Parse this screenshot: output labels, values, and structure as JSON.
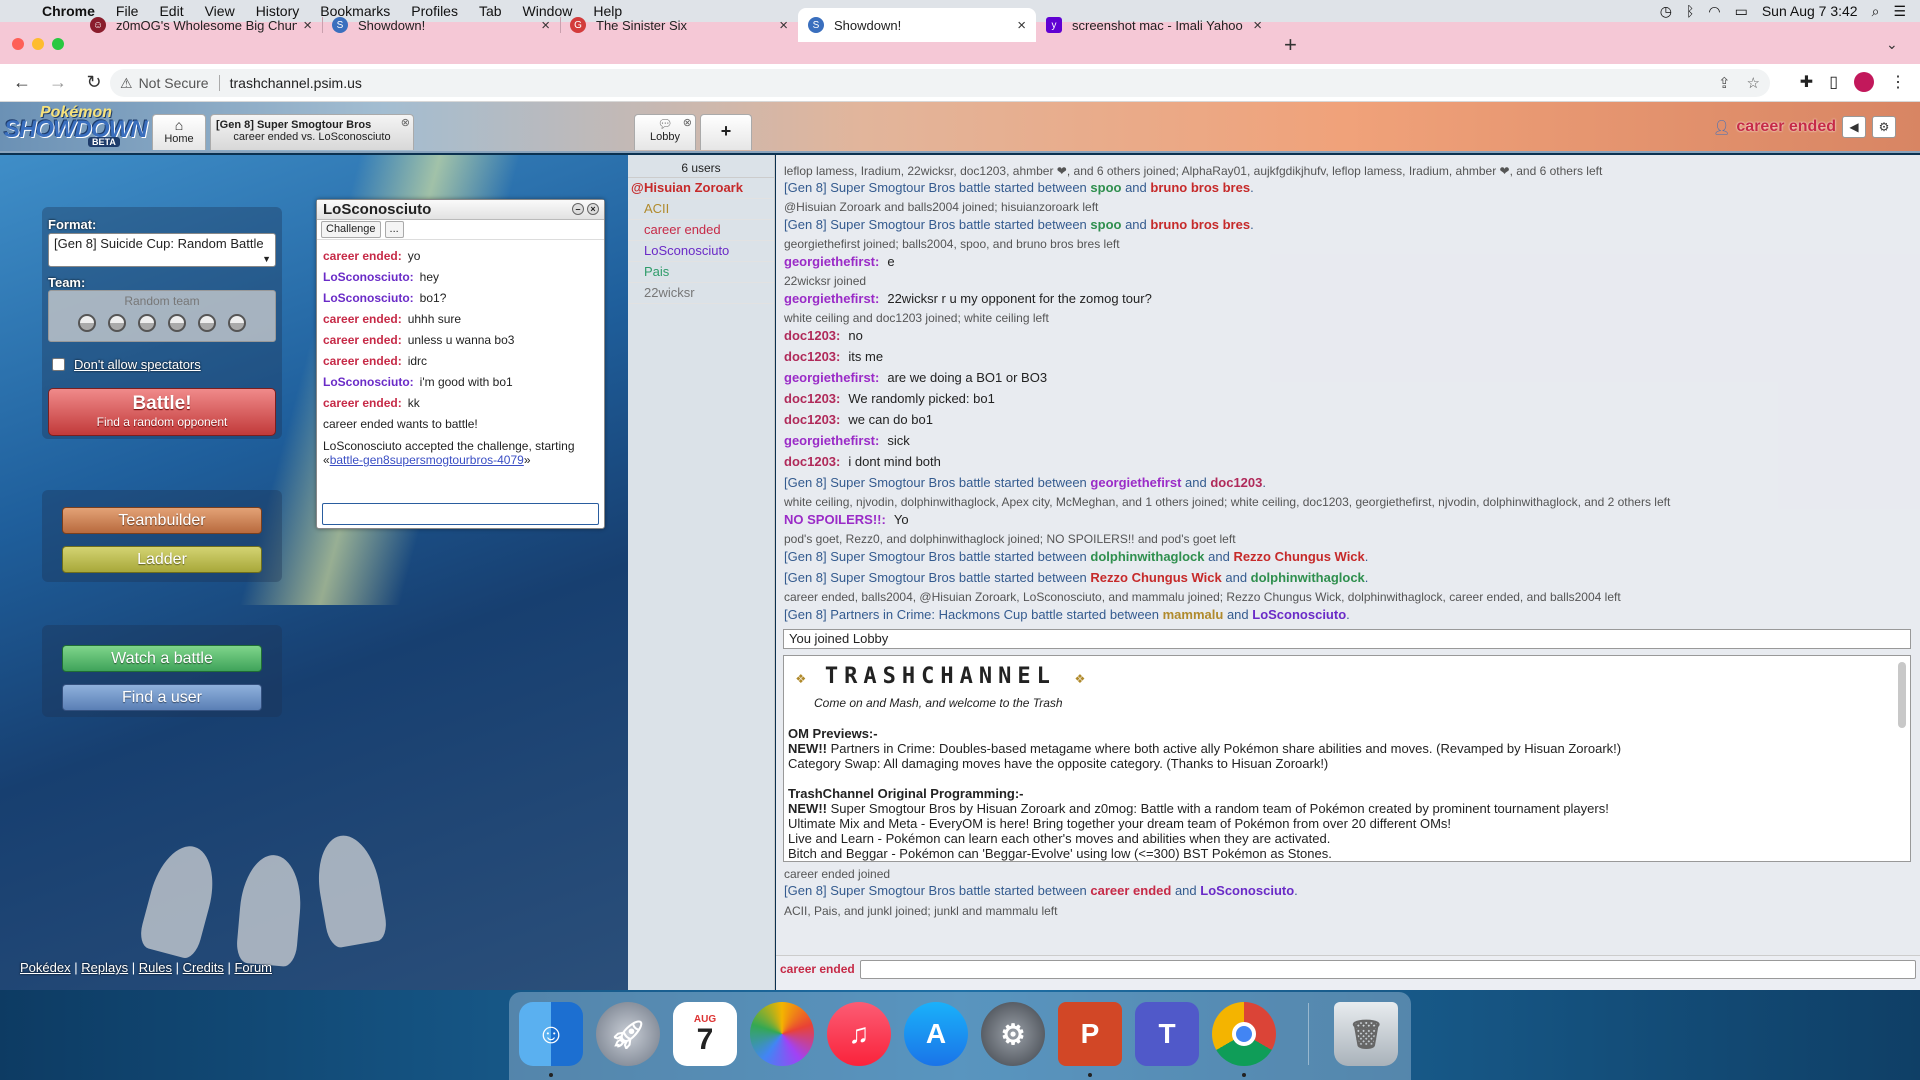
{
  "menubar": {
    "apple": "",
    "app": "Chrome",
    "items": [
      "File",
      "Edit",
      "View",
      "History",
      "Bookmarks",
      "Profiles",
      "Tab",
      "Window",
      "Help"
    ],
    "datetime": "Sun Aug 7  3:42"
  },
  "browser": {
    "tabs": [
      {
        "title": "z0mOG's Wholesome Big Chun",
        "fav_color": "#8a1d2c"
      },
      {
        "title": "Showdown!",
        "fav_color": "#3a6fbe"
      },
      {
        "title": "The Sinister Six",
        "fav_color": "#d33b3b"
      },
      {
        "title": "Showdown!",
        "fav_color": "#3a6fbe"
      },
      {
        "title": "screenshot mac - Imali Yahoo (",
        "fav_color": "#6001d2"
      }
    ],
    "new_tab": "+",
    "security": "Not Secure",
    "url": "trashchannel.psim.us"
  },
  "showdown": {
    "logo_top": "Pokémon",
    "logo_main": "SHOWDOWN",
    "logo_badge": "BETA",
    "home_tab": "Home",
    "battle_tab_title": "[Gen 8] Super Smogtour Bros",
    "battle_tab_sub": "career ended vs. LoSconosciuto",
    "lobby_tab": "Lobby",
    "add_tab": "+",
    "username": "career ended"
  },
  "home": {
    "format_label": "Format:",
    "format_value": "[Gen 8] Suicide Cup: Random Battle",
    "team_label": "Team:",
    "team_value": "Random team",
    "spectators": "Don't allow spectators",
    "battle_title": "Battle!",
    "battle_sub": "Find a random opponent",
    "teambuilder": "Teambuilder",
    "ladder": "Ladder",
    "watch": "Watch a battle",
    "find_user": "Find a user",
    "links": [
      "Pokédex",
      "Replays",
      "Rules",
      "Credits",
      "Forum"
    ]
  },
  "pm": {
    "title": "LoSconosciuto",
    "challenge": "Challenge",
    "more": "...",
    "messages": [
      {
        "user": "career ended:",
        "text": "yo",
        "color": "#c62a47"
      },
      {
        "user": "LoSconosciuto:",
        "text": "hey",
        "color": "#6a2bc7"
      },
      {
        "user": "LoSconosciuto:",
        "text": "bo1?",
        "color": "#6a2bc7"
      },
      {
        "user": "career ended:",
        "text": "uhhh sure",
        "color": "#c62a47"
      },
      {
        "user": "career ended:",
        "text": "unless u wanna bo3",
        "color": "#c62a47"
      },
      {
        "user": "career ended:",
        "text": "idrc",
        "color": "#c62a47"
      },
      {
        "user": "LoSconosciuto:",
        "text": "i'm good with bo1",
        "color": "#6a2bc7"
      },
      {
        "user": "career ended:",
        "text": "kk",
        "color": "#c62a47"
      }
    ],
    "challenge_msg": "career ended wants to battle!",
    "accepted_pre": "LoSconosciuto accepted the challenge, starting «",
    "accepted_link": "battle-gen8supersmogtourbros-4079",
    "accepted_post": "»"
  },
  "userlist": {
    "count": "6 users",
    "users": [
      {
        "name": "Hisuian Zoroark",
        "color": "#c62a2a",
        "rank": "@"
      },
      {
        "name": "ACII",
        "color": "#b08a2c",
        "rank": ""
      },
      {
        "name": "career ended",
        "color": "#c62a47",
        "rank": ""
      },
      {
        "name": "LoSconosciuto",
        "color": "#6a2bc7",
        "rank": ""
      },
      {
        "name": "Pais",
        "color": "#2f9c6a",
        "rank": ""
      },
      {
        "name": "22wicksr",
        "color": "#777777",
        "rank": ""
      }
    ]
  },
  "chat": {
    "l0": "leflop lamess, Iradium, 22wicksr, doc1203, ahmber ❤, and 6 others joined; AlphaRay01, aujkfgdikjhufv, leflop lamess, Iradium, ahmber ❤, and 6 others left",
    "b1": {
      "pre": "[Gen 8] Super Smogtour Bros battle started between ",
      "p1": "spoo",
      "mid": " and ",
      "p2": "bruno bros bres",
      "post": "."
    },
    "l2": "@Hisuian Zoroark and balls2004 joined; hisuianzoroark left",
    "b3": {
      "pre": "[Gen 8] Super Smogtour Bros battle started between ",
      "p1": "spoo",
      "mid": " and ",
      "p2": "bruno bros bres",
      "post": "."
    },
    "l4": "georgiethefirst joined; balls2004, spoo, and bruno bros bres left",
    "c5": {
      "user": "georgiethefirst:",
      "text": "e"
    },
    "l6": "22wicksr joined",
    "c7": {
      "user": "georgiethefirst:",
      "text": "22wicksr r u my opponent for the zomog tour?"
    },
    "l8": "white ceiling and doc1203 joined; white ceiling left",
    "c9": {
      "user": "doc1203:",
      "text": "no"
    },
    "c10": {
      "user": "doc1203:",
      "text": "its me"
    },
    "c11": {
      "user": "georgiethefirst:",
      "text": "are we doing a BO1 or BO3"
    },
    "c12": {
      "user": "doc1203:",
      "text": "We randomly picked: bo1"
    },
    "c13": {
      "user": "doc1203:",
      "text": "we can do bo1"
    },
    "c14": {
      "user": "georgiethefirst:",
      "text": "sick"
    },
    "c15": {
      "user": "doc1203:",
      "text": "i dont mind both"
    },
    "b16": {
      "pre": "[Gen 8] Super Smogtour Bros battle started between ",
      "p1": "georgiethefirst",
      "mid": " and ",
      "p2": "doc1203",
      "post": "."
    },
    "l17": "white ceiling, njvodin, dolphinwithaglock, Apex city, McMeghan, and 1 others joined; white ceiling, doc1203, georgiethefirst, njvodin, dolphinwithaglock, and 2 others left",
    "c18": {
      "user": "NO SPOILERS!!:",
      "text": "Yo"
    },
    "l19": "pod's goet, Rezz0, and dolphinwithaglock joined; NO SPOILERS!! and pod's goet left",
    "b20": {
      "pre": "[Gen 8] Super Smogtour Bros battle started between ",
      "p1": "dolphinwithaglock",
      "mid": " and ",
      "p2": "Rezzo Chungus Wick",
      "post": "."
    },
    "b21": {
      "pre": "[Gen 8] Super Smogtour Bros battle started between ",
      "p1": "Rezzo Chungus Wick",
      "mid": " and ",
      "p2": "dolphinwithaglock",
      "post": "."
    },
    "l22": "career ended, balls2004, @Hisuian Zoroark, LoSconosciuto, and mammalu joined; Rezzo Chungus Wick, dolphinwithaglock, career ended, and balls2004 left",
    "b23": {
      "pre": "[Gen 8] Partners in Crime: Hackmons Cup battle started between ",
      "p1": "mammalu",
      "mid": " and ",
      "p2": "LoSconosciuto",
      "post": "."
    },
    "joined": "You joined Lobby",
    "l24": "career ended joined",
    "b25": {
      "pre": "[Gen 8] Super Smogtour Bros battle started between ",
      "p1": "career ended",
      "mid": " and ",
      "p2": "LoSconosciuto",
      "post": "."
    },
    "l26": "ACII, Pais, and junkl joined; junkl and mammalu left",
    "input_name": "career ended"
  },
  "htmlbox": {
    "title": "TRASHCHANNEL",
    "tagline": "Come on and Mash, and welcome to the Trash",
    "om_head": "OM Previews:-",
    "om1_new": "NEW!!",
    "om1": " Partners in Crime: Doubles-based metagame where both active ally Pokémon share abilities and moves. (Revamped by Hisuan Zoroark!)",
    "om2": "Category Swap: All damaging moves have the opposite category. (Thanks to Hisuan Zoroark!)",
    "tc_head": "TrashChannel Original Programming:-",
    "tc1_new": "NEW!!",
    "tc1": " Super Smogtour Bros by Hisuan Zoroark and z0mog: Battle with a random team of Pokémon created by prominent tournament players!",
    "tc2": "Ultimate Mix and Meta - EveryOM is here! Bring together your dream team of Pokémon from over 20 different OMs!",
    "tc3": "Live and Learn - Pokémon can learn each other's moves and abilities when they are activated.",
    "tc4": "Bitch and Beggar - Pokémon can 'Beggar-Evolve' using low (<=300) BST Pokémon as Stones."
  },
  "colors": {
    "p_green": "#2f8f4e",
    "p_red": "#c62a2a",
    "p_purple": "#6a2bc7",
    "p_gold": "#b08a2c",
    "battle_blue": "#345b8f"
  },
  "dock": [
    "Finder",
    "Launchpad",
    "Calendar",
    "Photos",
    "Music",
    "App Store",
    "System Preferences",
    "PowerPoint",
    "Teams",
    "Chrome",
    "Trash"
  ],
  "dock_cal_month": "AUG",
  "dock_cal_day": "7"
}
